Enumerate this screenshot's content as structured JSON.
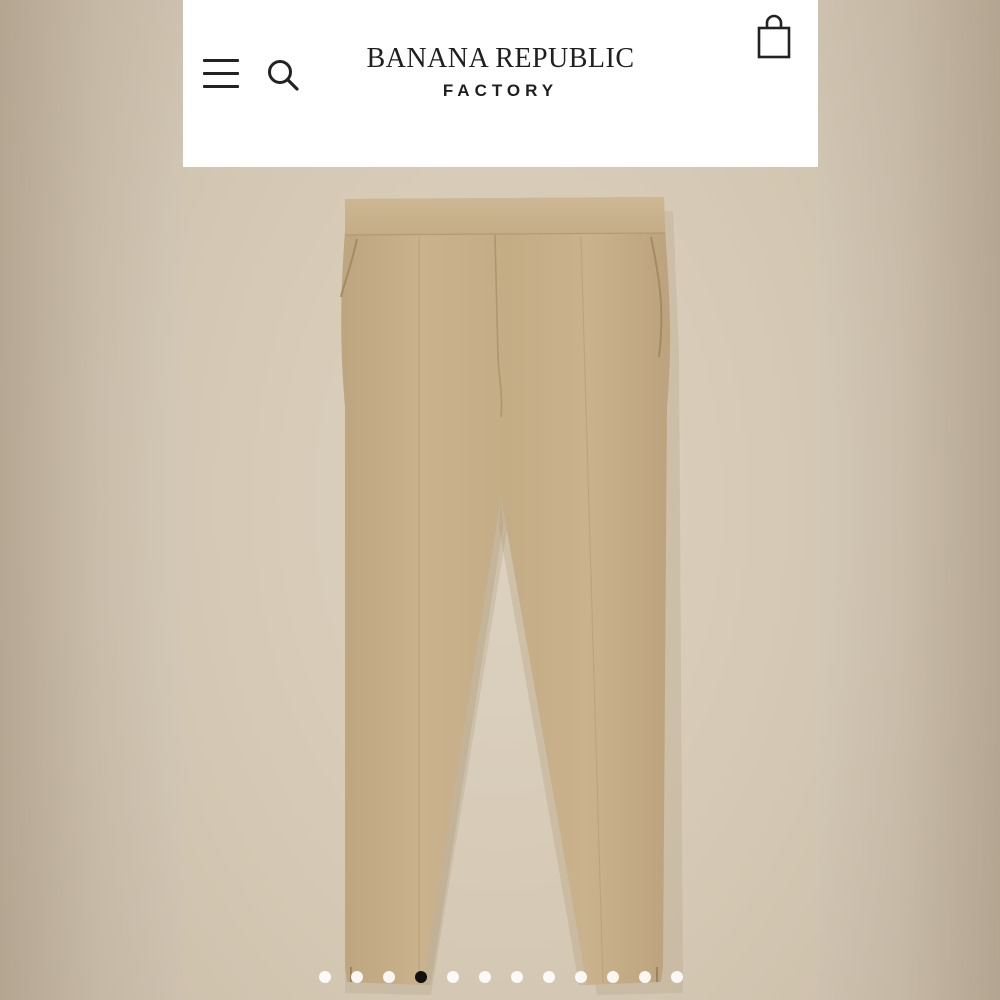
{
  "header": {
    "brand_name": "BANANA REPUBLIC",
    "brand_subtitle": "FACTORY",
    "icons": [
      "menu-icon",
      "search-icon",
      "shopping-bag-icon"
    ]
  },
  "product": {
    "image": "khaki-pants-image",
    "color": "#c7b08a"
  },
  "carousel": {
    "total_slides": 12,
    "active_index": 3
  },
  "colors": {
    "header_bg": "#ffffff",
    "page_bg": "#d9cdbb",
    "text": "#1f1f1f"
  }
}
